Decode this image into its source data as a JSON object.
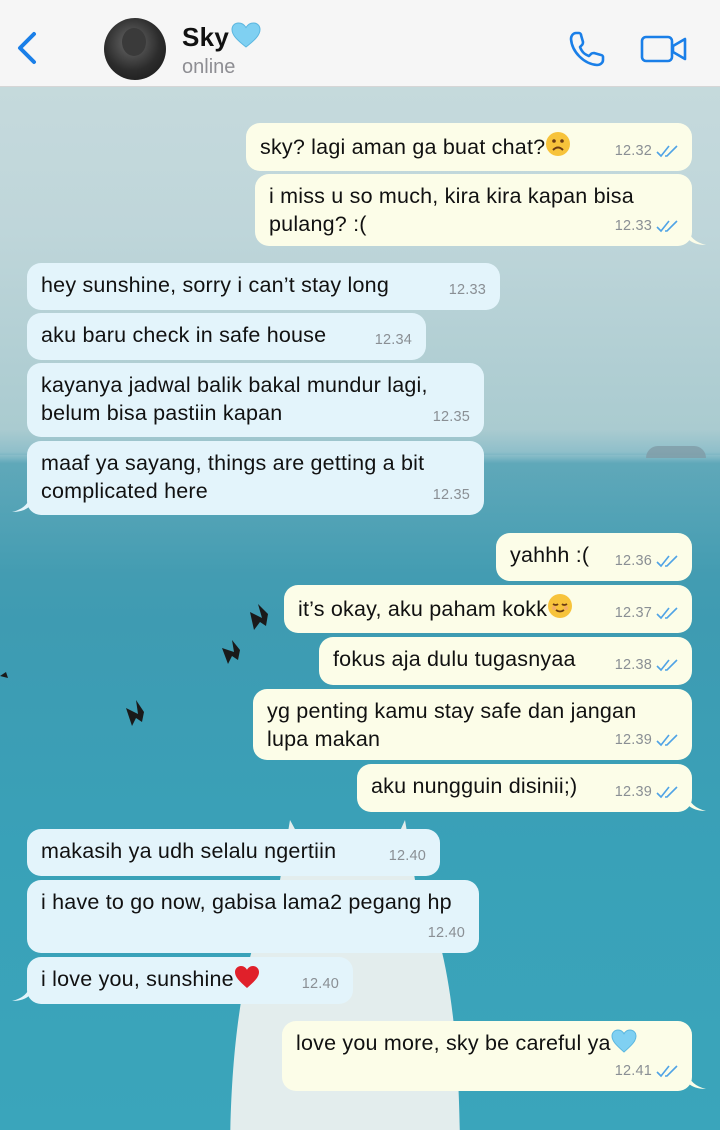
{
  "header": {
    "contact_name": "Sky",
    "contact_status": "online"
  },
  "messages": [
    {
      "dir": "out",
      "text": "sky? lagi aman ga buat chat?",
      "emoji": "frowning-face",
      "time": "12.32"
    },
    {
      "dir": "out",
      "text": "i miss u so much, kira kira kapan bisa pulang? :(",
      "time": "12.33"
    },
    {
      "dir": "in",
      "text": "hey sunshine, sorry i can’t stay long",
      "time": "12.33"
    },
    {
      "dir": "in",
      "text": "aku baru check in safe house",
      "time": "12.34"
    },
    {
      "dir": "in",
      "text": "kayanya jadwal balik bakal mundur lagi, belum bisa pastiin kapan",
      "time": "12.35"
    },
    {
      "dir": "in",
      "text": "maaf ya sayang, things are getting a bit complicated here",
      "time": "12.35"
    },
    {
      "dir": "out",
      "text": "yahhh :(",
      "time": "12.36"
    },
    {
      "dir": "out",
      "text": "it’s okay, aku paham kokk",
      "emoji": "relieved-face",
      "time": "12.37"
    },
    {
      "dir": "out",
      "text": "fokus aja dulu tugasnyaa",
      "time": "12.38"
    },
    {
      "dir": "out",
      "text": "yg penting kamu stay safe dan jangan lupa makan",
      "time": "12.39"
    },
    {
      "dir": "out",
      "text": "aku nungguin disinii;)",
      "time": "12.39"
    },
    {
      "dir": "in",
      "text": "makasih ya udh selalu ngertiin",
      "time": "12.40"
    },
    {
      "dir": "in",
      "text": "i have to go now, gabisa lama2 pegang hp",
      "time": "12.40"
    },
    {
      "dir": "in",
      "text": "i love you, sunshine",
      "emoji": "red-heart",
      "time": "12.40"
    },
    {
      "dir": "out",
      "text": "love you more, sky be careful ya",
      "emoji": "blue-heart",
      "time": "12.41"
    }
  ],
  "colors": {
    "accent": "#1a7fe8",
    "incoming_bubble": "#e3f4fb",
    "outgoing_bubble": "#fcfde8",
    "read_ticks": "#4fa3e6"
  },
  "icons": [
    "back-chevron-icon",
    "avatar",
    "blue-heart-icon",
    "phone-icon",
    "video-camera-icon",
    "double-check-icon"
  ]
}
